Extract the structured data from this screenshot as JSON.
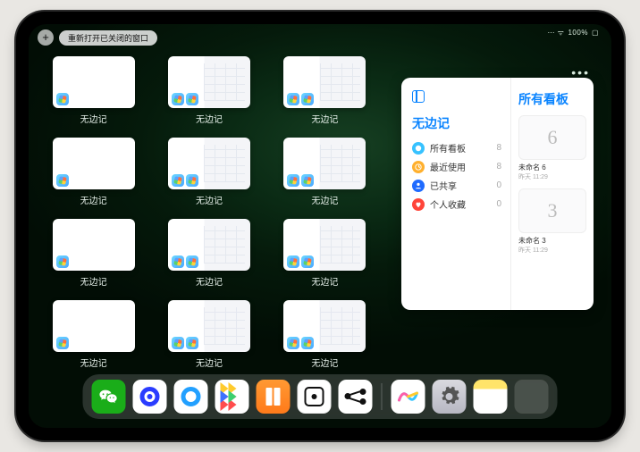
{
  "status": {
    "battery": "100%",
    "wifi": "⋯ ᯤ"
  },
  "topbar": {
    "plus": "+",
    "reopen_label": "重新打开已关闭的窗口"
  },
  "windows": [
    {
      "label": "无边记",
      "split": false
    },
    {
      "label": "无边记",
      "split": true
    },
    {
      "label": "无边记",
      "split": true
    },
    {
      "label": "无边记",
      "split": false
    },
    {
      "label": "无边记",
      "split": true
    },
    {
      "label": "无边记",
      "split": true
    },
    {
      "label": "无边记",
      "split": false
    },
    {
      "label": "无边记",
      "split": true
    },
    {
      "label": "无边记",
      "split": true
    },
    {
      "label": "无边记",
      "split": false
    },
    {
      "label": "无边记",
      "split": true
    },
    {
      "label": "无边记",
      "split": true
    }
  ],
  "sidebar": {
    "title": "无边记",
    "items": [
      {
        "label": "所有看板",
        "count": "8"
      },
      {
        "label": "最近使用",
        "count": "8"
      },
      {
        "label": "已共享",
        "count": "0"
      },
      {
        "label": "个人收藏",
        "count": "0"
      }
    ]
  },
  "boards_panel": {
    "title": "所有看板",
    "boards": [
      {
        "glyph": "6",
        "name": "未命名 6",
        "time": "昨天 11:29"
      },
      {
        "glyph": "3",
        "name": "未命名 3",
        "time": "昨天 11:29"
      }
    ]
  },
  "dock": {
    "apps": [
      "wechat",
      "quark",
      "qqbrowser",
      "play",
      "books",
      "dice",
      "graph",
      "freeform",
      "settings",
      "notes"
    ]
  }
}
